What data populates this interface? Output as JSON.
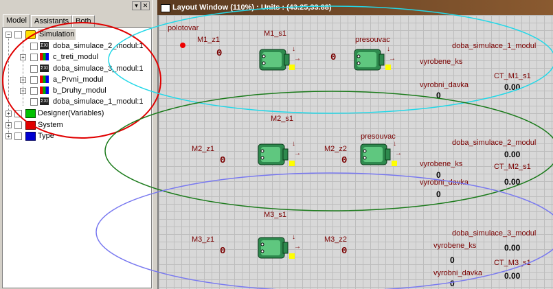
{
  "left_panel": {
    "tabs": [
      "Model",
      "Assistants",
      "Both"
    ],
    "tree": [
      {
        "label": "Simulation",
        "level": 0,
        "expand": "minus"
      },
      {
        "label": "doba_simulace_2_modul:1",
        "level": 1,
        "expand": ""
      },
      {
        "label": "c_treti_modul",
        "level": 1,
        "expand": "plus"
      },
      {
        "label": "doba_simulace_3_modul:1",
        "level": 1,
        "expand": ""
      },
      {
        "label": "a_Prvni_modul",
        "level": 1,
        "expand": "plus"
      },
      {
        "label": "b_Druhy_modul",
        "level": 1,
        "expand": "plus"
      },
      {
        "label": "doba_simulace_1_modul:1",
        "level": 1,
        "expand": ""
      },
      {
        "label": "Designer(Variables)",
        "level": 0,
        "expand": "plus"
      },
      {
        "label": "System",
        "level": 0,
        "expand": "plus"
      },
      {
        "label": "Type",
        "level": 0,
        "expand": "plus"
      }
    ],
    "window_buttons": [
      "▾",
      "✕"
    ]
  },
  "layout_window": {
    "title": "Layout Window (110%) : Units : (43.25,33.88)"
  },
  "canvas": {
    "polotovar": "polotovar",
    "row1": {
      "z1": "M1_z1",
      "s1": "M1_s1",
      "presouvac": "presouvac",
      "doba": "doba_simulace_1_modul",
      "vyrobene": "vyrobene_ks",
      "ct": "CT_M1_s1",
      "davka": "vyrobni_davka",
      "ct_val": "0.00",
      "davka_val": "0",
      "zero": "0"
    },
    "row2": {
      "header": "M2_s1",
      "z1": "M2_z1",
      "z2": "M2_z2",
      "presouvac": "presouvac",
      "doba": "doba_simulace_2_modul",
      "vyrobene": "vyrobene_ks",
      "vyrobene_val": "0",
      "ct": "CT_M2_s1",
      "ct_val": "0.00",
      "davka": "vyrobni_davka",
      "davka_val": "0",
      "doba_val": "0.00",
      "zero": "0"
    },
    "row3": {
      "header": "M3_s1",
      "z1": "M3_z1",
      "z2": "M3_z2",
      "doba": "doba_simulace_3_modul",
      "vyrobene": "vyrobene_ks",
      "vyrobene_val": "0",
      "vyrobene_num": "0.00",
      "ct": "CT_M3_s1",
      "ct_val": "0.00",
      "davka": "vyrobni_davka",
      "davka_val": "0",
      "zero": "0"
    }
  },
  "colors": {
    "ellipse_red": "#e00000",
    "ellipse_cyan": "#22d8e8",
    "ellipse_green": "#1a7a1a",
    "ellipse_blue": "#7878f0",
    "text_dark_red": "#7a0000"
  }
}
